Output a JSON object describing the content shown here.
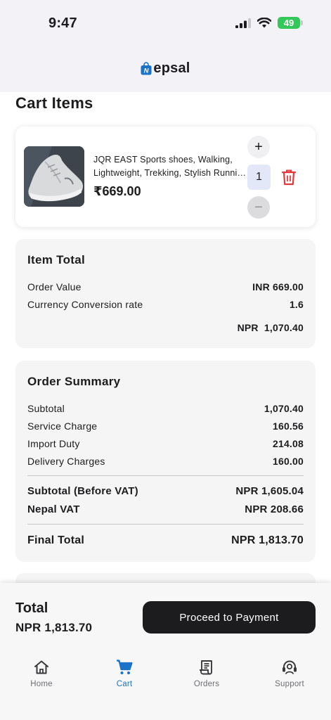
{
  "status_bar": {
    "time": "9:47",
    "battery": "49"
  },
  "app": {
    "brand": "epsal",
    "logo_letter": "N"
  },
  "page_title": "Cart Items",
  "cart": {
    "items": [
      {
        "name": "JQR EAST Sports shoes, Walking, Lightweight, Trekking, Stylish Running Shoes",
        "price": "₹669.00",
        "quantity": "1",
        "plus_label": "+",
        "minus_label": "−"
      }
    ]
  },
  "item_total": {
    "title": "Item Total",
    "order_value_label": "Order Value",
    "order_value": "INR 669.00",
    "conversion_label": "Currency Conversion rate",
    "conversion_rate": "1.6",
    "converted_total": "NPR  1,070.40"
  },
  "order_summary": {
    "title": "Order Summary",
    "rows": [
      {
        "label": "Subtotal",
        "value": "1,070.40"
      },
      {
        "label": "Service Charge",
        "value": "160.56"
      },
      {
        "label": "Import Duty",
        "value": "214.08"
      },
      {
        "label": "Delivery Charges",
        "value": "160.00"
      }
    ],
    "subtotal_before_vat_label": "Subtotal (Before VAT)",
    "subtotal_before_vat": "NPR 1,605.04",
    "vat_label": "Nepal VAT",
    "vat": "NPR 208.66",
    "final_total_label": "Final Total",
    "final_total": "NPR 1,813.70"
  },
  "footer": {
    "total_label": "Total",
    "total_amount": "NPR 1,813.70",
    "pay_button": "Proceed to Payment"
  },
  "tabs": [
    {
      "label": "Home",
      "icon": "home-icon",
      "active": false
    },
    {
      "label": "Cart",
      "icon": "cart-icon",
      "active": true
    },
    {
      "label": "Orders",
      "icon": "receipt-icon",
      "active": false
    },
    {
      "label": "Support",
      "icon": "headset-icon",
      "active": false
    }
  ],
  "colors": {
    "accent": "#1a73c8",
    "delete": "#e5383b",
    "battery": "#34c759",
    "button_dark": "#1c1c1e"
  }
}
